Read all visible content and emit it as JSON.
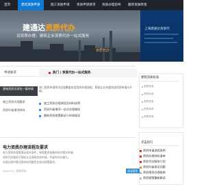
{
  "nav": {
    "items": [
      {
        "label": "首页"
      },
      {
        "label": "建筑资质申请"
      },
      {
        "label": "施工资质申请"
      },
      {
        "label": "资质申请要求"
      },
      {
        "label": "资质办理指导"
      },
      {
        "label": "最新资质政策"
      }
    ],
    "active_index": 1
  },
  "hero": {
    "title_prefix": "建通达",
    "title_accent": "资质代办",
    "subtitle": "设资质办理，建筑企业资质代办一站式服务",
    "right_title": "上海建通达资质代",
    "watermark": "资质代办",
    "accent_color": "#f5a31a",
    "panel_color": "#0b3a73"
  },
  "sidebar": {
    "title": "申请要求",
    "items": [
      {
        "label": "建筑资质总承包一级申请"
      },
      {
        "label": "施工资质办理要求"
      },
      {
        "label": "资质升级增项材料"
      }
    ]
  },
  "news": {
    "headline": "热门 | 资质代办一站式服务",
    "para": "热门资质申请资讯全面覆盖各类资质办理流程，帮助企业快速完成资质申请与升级。",
    "bullets": [
      {
        "label": "施工资质办理流程及材料说明"
      },
      {
        "label": "资质升级增项一站式办理服务"
      },
      {
        "label": "最新资质政策解读与申请指导"
      }
    ]
  },
  "right": {
    "box1_title": "建筑资质标准",
    "box1_items": [
      {
        "label": "资质标准"
      },
      {
        "label": "资质标准"
      },
      {
        "label": "资质标准"
      },
      {
        "label": "资质标准"
      },
      {
        "label": "资质标准"
      }
    ],
    "box2_title": "点击排行",
    "box2_items": [
      {
        "label": "资质申请流程说明"
      },
      {
        "label": "资质办理材料清单"
      },
      {
        "label": "资质代办服务介绍"
      },
      {
        "label": "资质升级常见问题"
      },
      {
        "label": "资质增项办理指南"
      },
      {
        "label": "资质政策最新解读"
      }
    ]
  },
  "article": {
    "title": "电力资质办理流程及要求",
    "summary_lines": [
      "电力资质办理需满足相关条件，按照要求准备材料并提交申请。",
      "资质代办服务可帮助企业高效完成申请，节省时间与精力。",
      "办理过程中需注意材料完整性及相关政策要求。"
    ],
    "meta": "2023-03 | 资质代办",
    "button_label": "阅读更多"
  }
}
